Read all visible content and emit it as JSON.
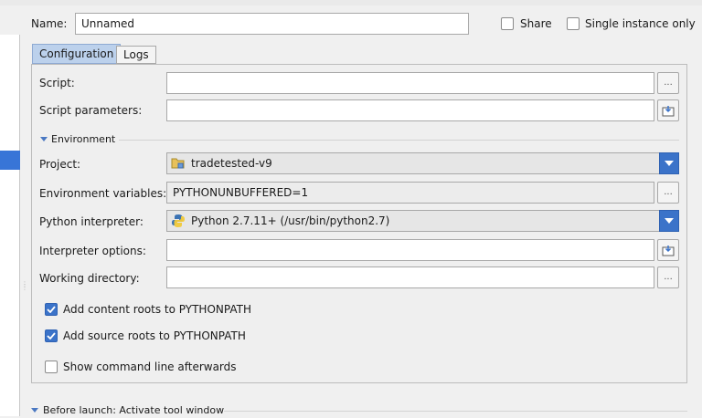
{
  "header": {
    "name_label": "Name:",
    "name_value": "Unnamed",
    "share_label": "Share",
    "single_instance_label": "Single instance only"
  },
  "tabs": [
    {
      "label": "Configuration",
      "active": true
    },
    {
      "label": "Logs",
      "active": false
    }
  ],
  "config": {
    "script_label": "Script:",
    "script_value": "",
    "script_params_label": "Script parameters:",
    "script_params_value": "",
    "environment_section_label": "Environment",
    "project_label": "Project:",
    "project_value": "tradetested-v9",
    "env_vars_label": "Environment variables:",
    "env_vars_value": "PYTHONUNBUFFERED=1",
    "interpreter_label": "Python interpreter:",
    "interpreter_value": "Python 2.7.11+ (/usr/bin/python2.7)",
    "interpreter_options_label": "Interpreter options:",
    "interpreter_options_value": "",
    "working_dir_label": "Working directory:",
    "working_dir_value": "",
    "browse_label": "...",
    "add_content_roots_label": "Add content roots to PYTHONPATH",
    "add_content_roots_checked": true,
    "add_source_roots_label": "Add source roots to PYTHONPATH",
    "add_source_roots_checked": true,
    "show_cmd_label": "Show command line afterwards",
    "show_cmd_checked": false
  },
  "before_launch": {
    "label": "Before launch: Activate tool window"
  },
  "colors": {
    "accent": "#3b73c9",
    "tab_active": "#bcd1ec",
    "selection": "#3875d7"
  },
  "icons": {
    "dropdown": "chevron-down-icon",
    "browse": "ellipsis-icon",
    "expand": "expand-field-icon",
    "project": "project-folder-icon",
    "python": "python-icon"
  }
}
